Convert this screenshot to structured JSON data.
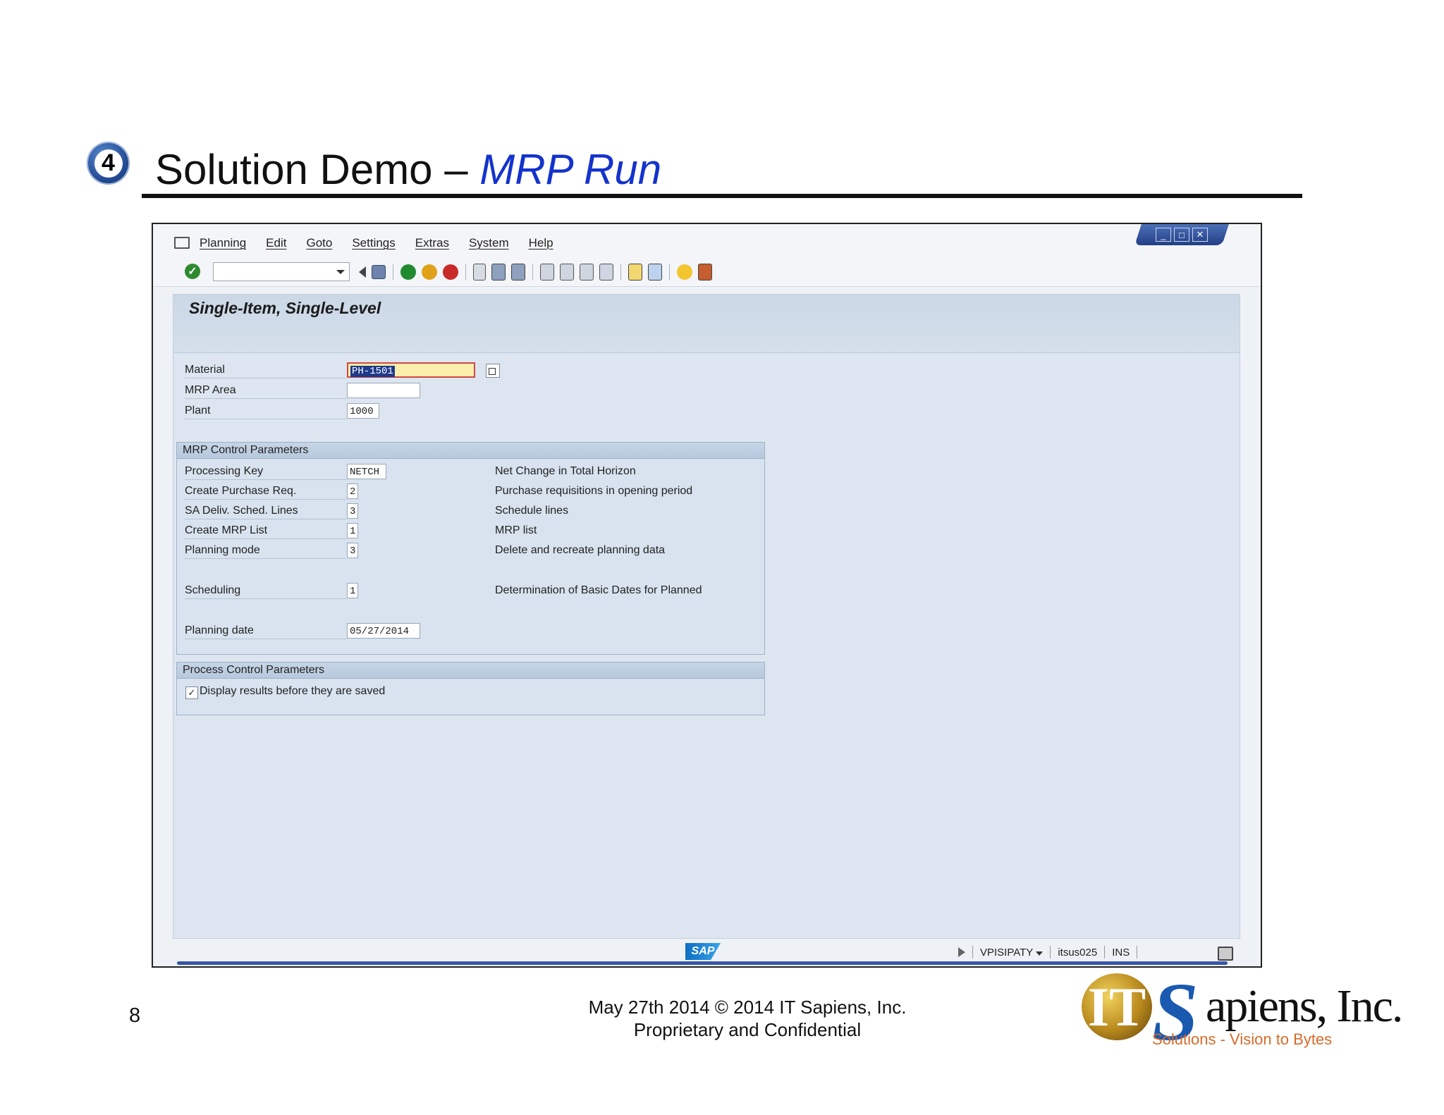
{
  "slide": {
    "step": "4",
    "title_main": "Solution Demo – ",
    "title_sub": "MRP Run",
    "page_number": "8",
    "footer_line1": "May 27th 2014    © 2014 IT Sapiens, Inc.",
    "footer_line2": "Proprietary and Confidential",
    "logo": {
      "initials": "IT",
      "s": "S",
      "company": "apiens, Inc.",
      "tagline": "Solutions - Vision to Bytes"
    }
  },
  "sap": {
    "menu": [
      "Planning",
      "Edit",
      "Goto",
      "Settings",
      "Extras",
      "System",
      "Help"
    ],
    "screen_title": "Single-Item, Single-Level",
    "header_fields": [
      {
        "label": "Material",
        "value": "PH-1501"
      },
      {
        "label": "MRP Area",
        "value": ""
      },
      {
        "label": "Plant",
        "value": "1000"
      }
    ],
    "group1": {
      "title": "MRP Control Parameters",
      "rows": [
        {
          "label": "Processing Key",
          "value": "NETCH",
          "desc": "Net Change in Total Horizon"
        },
        {
          "label": "Create Purchase Req.",
          "value": "2",
          "desc": "Purchase requisitions in opening period"
        },
        {
          "label": "SA Deliv. Sched. Lines",
          "value": "3",
          "desc": "Schedule lines"
        },
        {
          "label": "Create MRP List",
          "value": "1",
          "desc": "MRP list"
        },
        {
          "label": "Planning mode",
          "value": "3",
          "desc": "Delete and recreate planning data"
        },
        {
          "label": "Scheduling",
          "value": "1",
          "desc": "Determination of Basic Dates for Planned"
        },
        {
          "label": "Planning date",
          "value": "05/27/2014",
          "desc": ""
        }
      ]
    },
    "group2": {
      "title": "Process Control Parameters",
      "checkbox_label": "Display results before they are saved",
      "checked": true
    },
    "status": {
      "logo": "SAP",
      "system": "VPISIPATY",
      "server": "itsus025",
      "mode": "INS"
    }
  },
  "colors": {
    "title_accent": "#1433cc",
    "sap_bg": "#dde6f0",
    "required_field": "#fbeeaa"
  }
}
